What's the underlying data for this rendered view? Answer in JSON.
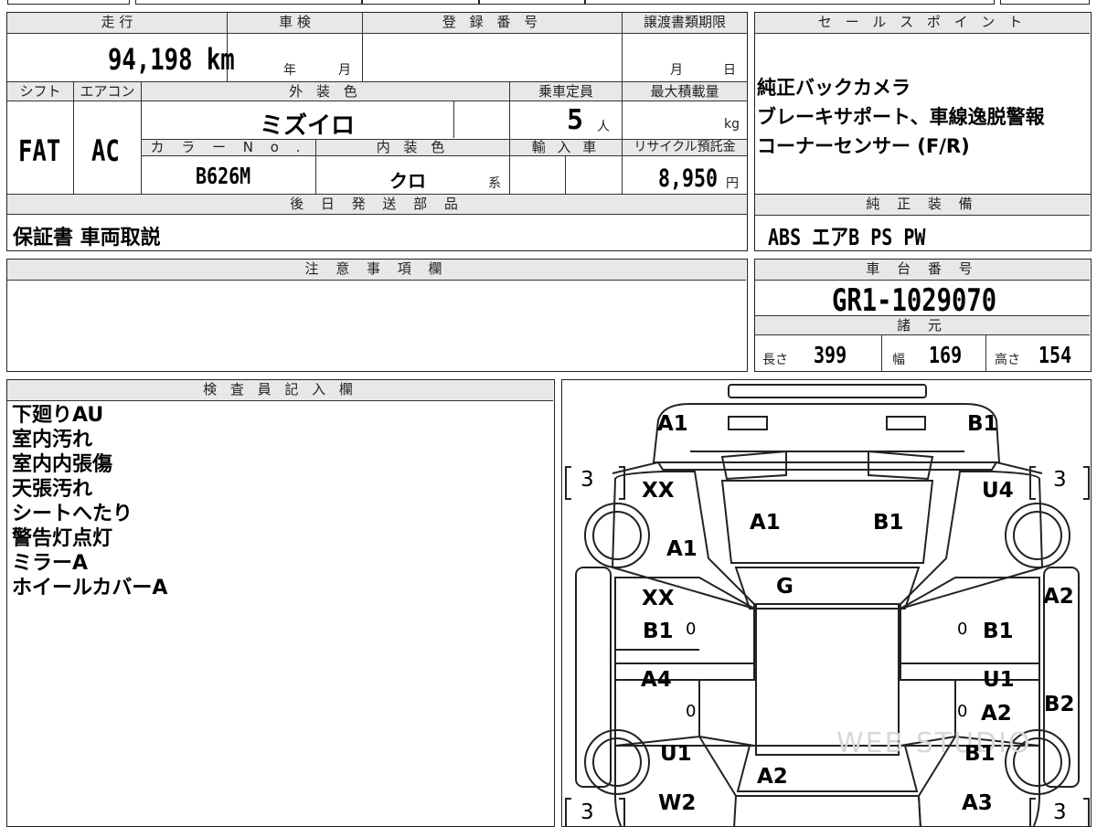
{
  "vehicle": {
    "mileage_label": "走 行",
    "mileage": "94,198",
    "mileage_unit": "km",
    "inspection_label": "車 検",
    "inspection_year": "年",
    "inspection_month": "月",
    "reg_number_label": "登 録 番 号",
    "transfer_deadline_label": "譲渡書類期限",
    "transfer_month": "月",
    "transfer_day": "日",
    "shift_label": "シフト",
    "shift": "FAT",
    "ac_label": "エアコン",
    "ac": "AC",
    "exterior_color_label": "外 装 色",
    "exterior_color": "ミズイロ",
    "capacity_label": "乗車定員",
    "capacity": "5",
    "capacity_unit": "人",
    "max_load_label": "最大積載量",
    "max_load_unit": "kg",
    "color_no_label": "カ ラ ー N o .",
    "color_no": "B626M",
    "interior_color_label": "内 装 色",
    "interior_color": "クロ",
    "interior_suffix": "系",
    "import_label": "輸 入 車",
    "recycle_label": "リサイクル預託金",
    "recycle_fee": "8,950",
    "recycle_unit": "円",
    "later_parts_label": "後 日 発 送 部 品",
    "later_parts": "保証書 車両取説"
  },
  "sales_points": {
    "label": "セ ー ル ス ポ イ ン ト",
    "lines": [
      "純正バックカメラ",
      "ブレーキサポート、車線逸脱警報",
      "コーナーセンサー (F/R)"
    ]
  },
  "equipment": {
    "label": "純 正 装 備",
    "value": "ABS エアB PS PW"
  },
  "remarks": {
    "label": "注 意 事 項 欄"
  },
  "chassis": {
    "label": "車 台 番 号",
    "number": "GR1-1029070",
    "specs_label": "諸 元",
    "length_label": "長さ",
    "length": "399",
    "width_label": "幅",
    "width": "169",
    "height_label": "高さ",
    "height": "154"
  },
  "inspector": {
    "label": "検 査 員 記 入 欄",
    "notes": [
      "下廻りAU",
      "室内汚れ",
      "室内内張傷",
      "天張汚れ",
      "シートへたり",
      "警告灯点灯",
      "ミラーA",
      "ホイールカバーA"
    ]
  },
  "diagram": {
    "marks": {
      "front_bumper_left": "A1",
      "front_bumper_right": "B1",
      "tire_fl": "3",
      "tire_fr": "3",
      "tire_rl": "3",
      "tire_rr": "3",
      "fender_fl_top": "XX",
      "fender_fl_bottom": "A1",
      "fender_fr": "U4",
      "hood_left": "A1",
      "hood_right": "B1",
      "windshield": "G",
      "door_fl_top": "XX",
      "door_fl_bottom": "B1",
      "door_fl_zero": "0",
      "door_fr": "B1",
      "door_fr_zero": "0",
      "door_rl": "A4",
      "door_rl_zero": "0",
      "door_rr_top": "U1",
      "door_rr_bottom": "A2",
      "door_rr_zero": "0",
      "pillar_right_top": "A2",
      "pillar_right_bottom": "B2",
      "quarter_rl": "U1",
      "quarter_rl_bottom": "W2",
      "quarter_rr": "B1",
      "quarter_rr_bottom": "A3",
      "roof_rear": "A2"
    },
    "watermark": "WEB STUDIO"
  }
}
